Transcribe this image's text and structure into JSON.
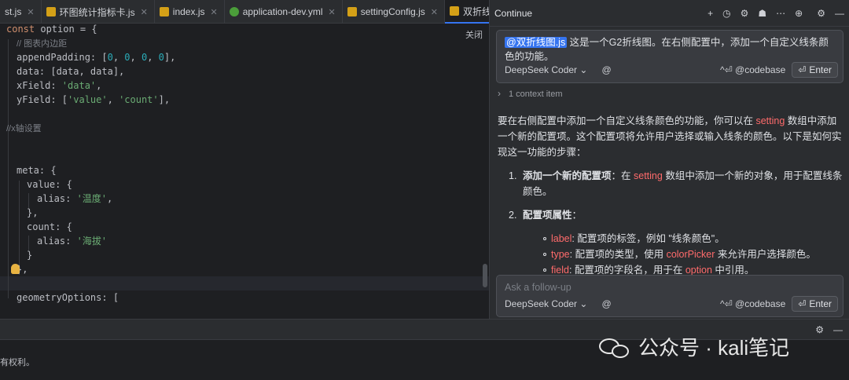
{
  "tabs": [
    {
      "label": "st.js",
      "type": "js",
      "active": false
    },
    {
      "label": "环图统计指标卡.js",
      "type": "js",
      "active": false
    },
    {
      "label": "index.js",
      "type": "js",
      "active": false
    },
    {
      "label": "application-dev.yml",
      "type": "yml",
      "active": false
    },
    {
      "label": "settingConfig.js",
      "type": "js",
      "active": false
    },
    {
      "label": "双折线图.js",
      "type": "js",
      "active": true
    }
  ],
  "editor": {
    "close_label": "关闭",
    "code": {
      "l1_kw": "const",
      "l1_rest": " option = {",
      "l2_comment": "// 图表内边距",
      "l3_a": "appendPadding: [",
      "l3_n1": "0",
      "l3_n2": "0",
      "l3_n3": "0",
      "l3_n4": "0",
      "l3_b": "],",
      "l4": "data: [data, data],",
      "l5_a": "xField: ",
      "l5_str": "'data'",
      "l5_b": ",",
      "l6_a": "yField: [",
      "l6_s1": "'value'",
      "l6_s2": "'count'",
      "l6_b": "],",
      "l8_comment": "//x轴设置",
      "l11": "meta: {",
      "l12": "value: {",
      "l13_a": "alias: ",
      "l13_str": "'温度'",
      "l13_b": ",",
      "l14": "},",
      "l15": "count: {",
      "l16_a": "alias: ",
      "l16_str": "'海拔'",
      "l17": "}",
      "l18": "},",
      "l20": "geometryOptions: ["
    }
  },
  "continue_panel": {
    "title": "Continue",
    "header_icons": [
      "plus-icon",
      "history-icon",
      "gear-icon",
      "user-icon",
      "more-icon",
      "globe-icon",
      "settings-icon",
      "minimize-icon"
    ],
    "user_message": {
      "mention": "@双折线图.js",
      "text": " 这是一个G2折线图。在右侧配置中，添加一个自定义线条颜色的功能。"
    },
    "model_select": "DeepSeek Coder",
    "at_symbol": "@",
    "codebase_hint": "^⏎ @codebase",
    "enter_label": "Enter",
    "context_label": "1 context item",
    "answer": {
      "p1_a": "要在右侧配置中添加一个自定义线条颜色的功能，你可以在 ",
      "p1_hl": "setting",
      "p1_b": " 数组中添加一个新的配置项。这个配置项将允许用户选择或输入线条的颜色。以下是如何实现这一功能的步骤：",
      "i1_num": "1.",
      "i1_bold": "添加一个新的配置项",
      "i1_a": "：在 ",
      "i1_hl": "setting",
      "i1_b": " 数组中添加一个新的对象，用于配置线条颜色。",
      "i2_num": "2.",
      "i2_bold": "配置项属性",
      "i2_a": "：",
      "sub1_hl": "label",
      "sub1_text": ": 配置项的标签，例如 \"线条颜色\"。",
      "sub2_hl": "type",
      "sub2_a": ": 配置项的类型，使用 ",
      "sub2_hl2": "colorPicker",
      "sub2_b": " 来允许用户选择颜色。",
      "sub3_hl": "field",
      "sub3_a": ": 配置项的字段名，用于在 ",
      "sub3_hl2": "option",
      "sub3_b": " 中引用。"
    },
    "followup_placeholder": "Ask a follow-up"
  },
  "bottom": {
    "footer_text": "有权利。",
    "watermark": "公众号 · kali笔记"
  }
}
